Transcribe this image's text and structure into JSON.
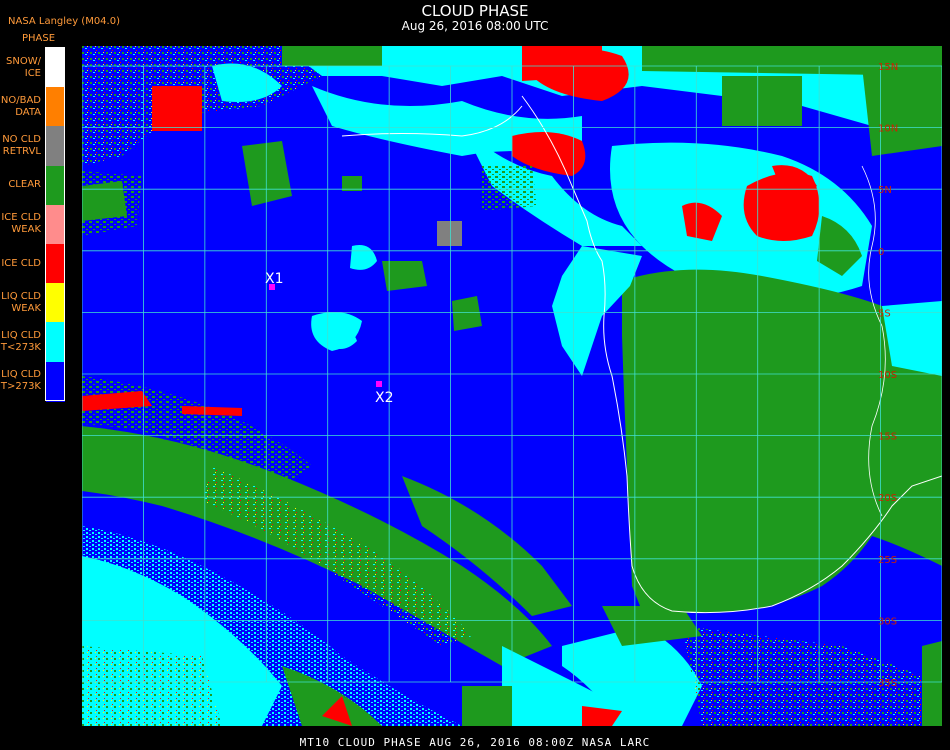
{
  "header": {
    "source": "NASA Langley (M04.0)",
    "title": "CLOUD PHASE",
    "datetime": "Aug 26, 2016 08:00 UTC"
  },
  "legend": {
    "heading": "PHASE",
    "items": [
      {
        "label": "SNOW/\nICE",
        "color": "#ffffff"
      },
      {
        "label": "NO/BAD\nDATA",
        "color": "#ff7f00"
      },
      {
        "label": "NO CLD\nRETRVL",
        "color": "#808080"
      },
      {
        "label": "CLEAR",
        "color": "#1e9a1e"
      },
      {
        "label": "ICE CLD\nWEAK",
        "color": "#ff8c8c"
      },
      {
        "label": "ICE CLD",
        "color": "#ff0000"
      },
      {
        "label": "LIQ CLD\nWEAK",
        "color": "#ffff00"
      },
      {
        "label": "LIQ CLD\nT<273K",
        "color": "#00ffff"
      },
      {
        "label": "LIQ CLD\nT>273K",
        "color": "#0000ff"
      }
    ]
  },
  "markers": [
    {
      "label": "X1"
    },
    {
      "label": "X2"
    }
  ],
  "grid_labels": [
    "15N",
    "10N",
    "5N",
    "0",
    "5S",
    "10S",
    "15S",
    "20S",
    "25S",
    "30S",
    "35S"
  ],
  "colors": {
    "ocean_liquid": "#0000ff",
    "clear": "#1e9a1e",
    "liquid_cold": "#00ffff",
    "ice": "#ff0000",
    "grid": "#40e0d0",
    "marker": "#ff00ff",
    "coast": "#ffffff"
  },
  "footer": "MT10  CLOUD PHASE   AUG 26, 2016 08:00Z   NASA LARC"
}
